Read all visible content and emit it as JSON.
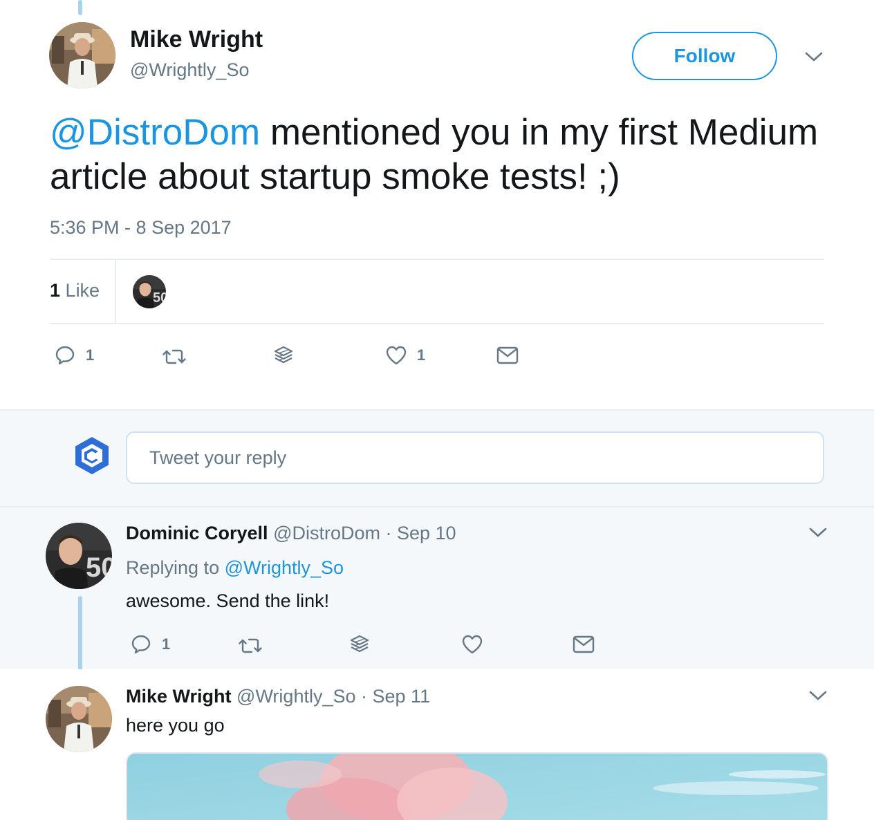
{
  "main_tweet": {
    "author_name": "Mike Wright",
    "author_handle": "@Wrightly_So",
    "follow_label": "Follow",
    "text_mention": "@DistroDom",
    "text_body": " mentioned you in my first Medium article about startup smoke tests! ;)",
    "timestamp": "5:36 PM - 8 Sep 2017",
    "likes_count": "1",
    "likes_label": "Like",
    "actions": {
      "reply_count": "1",
      "like_count": "1"
    }
  },
  "reply_box": {
    "placeholder": "Tweet your reply"
  },
  "replies": [
    {
      "author_name": "Dominic Coryell",
      "author_handle": "@DistroDom",
      "date": "· Sep 10",
      "replying_prefix": "Replying to",
      "replying_to": "@Wrightly_So",
      "text": "awesome. Send the link!",
      "reply_count": "1"
    },
    {
      "author_name": "Mike Wright",
      "author_handle": "@Wrightly_So",
      "date": "· Sep 11",
      "text": "here you go"
    }
  ],
  "icons": [
    "caret-down-icon",
    "reply-icon",
    "retweet-icon",
    "stack-icon",
    "heart-icon",
    "mail-icon",
    "brand-logo-icon"
  ],
  "colors": {
    "accent": "#1b95e0",
    "muted": "#657786",
    "thread_line": "#a9d2ef",
    "reply_bg": "#f5f8fa"
  }
}
